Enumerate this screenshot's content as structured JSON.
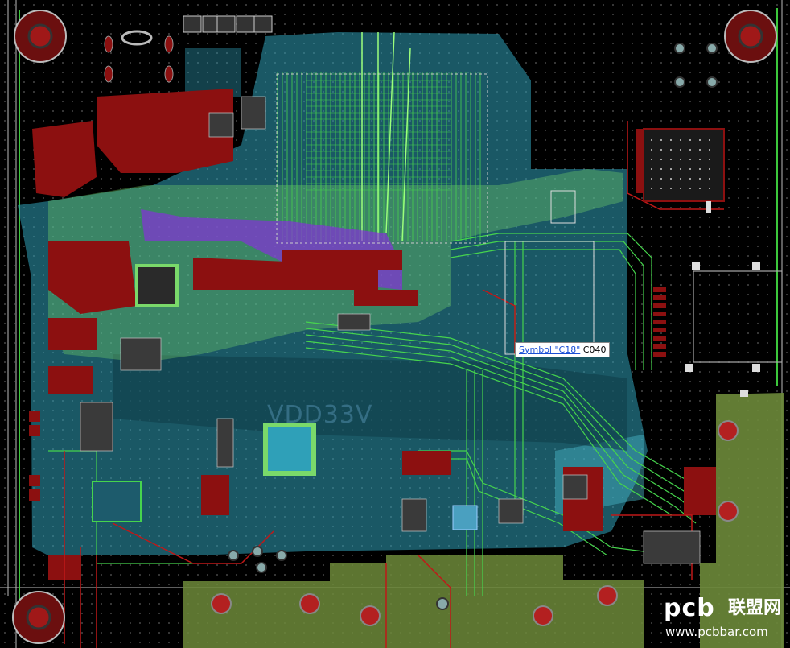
{
  "board": {
    "net_label": "VDD33V",
    "colors": {
      "background": "#000000",
      "top_copper": "#8c1010",
      "inner_plane": "#2fa0b8",
      "signal_trace": "#44d24a",
      "bottom_pour": "#6d8a3a",
      "highlight": "#8a2be2"
    }
  },
  "tooltip": {
    "link_text": "Symbol \"C18\"",
    "ref_text": "C040"
  },
  "watermark": {
    "brand": "pcb",
    "cn_text": "联盟网",
    "url": "www.pcbbar.com"
  }
}
